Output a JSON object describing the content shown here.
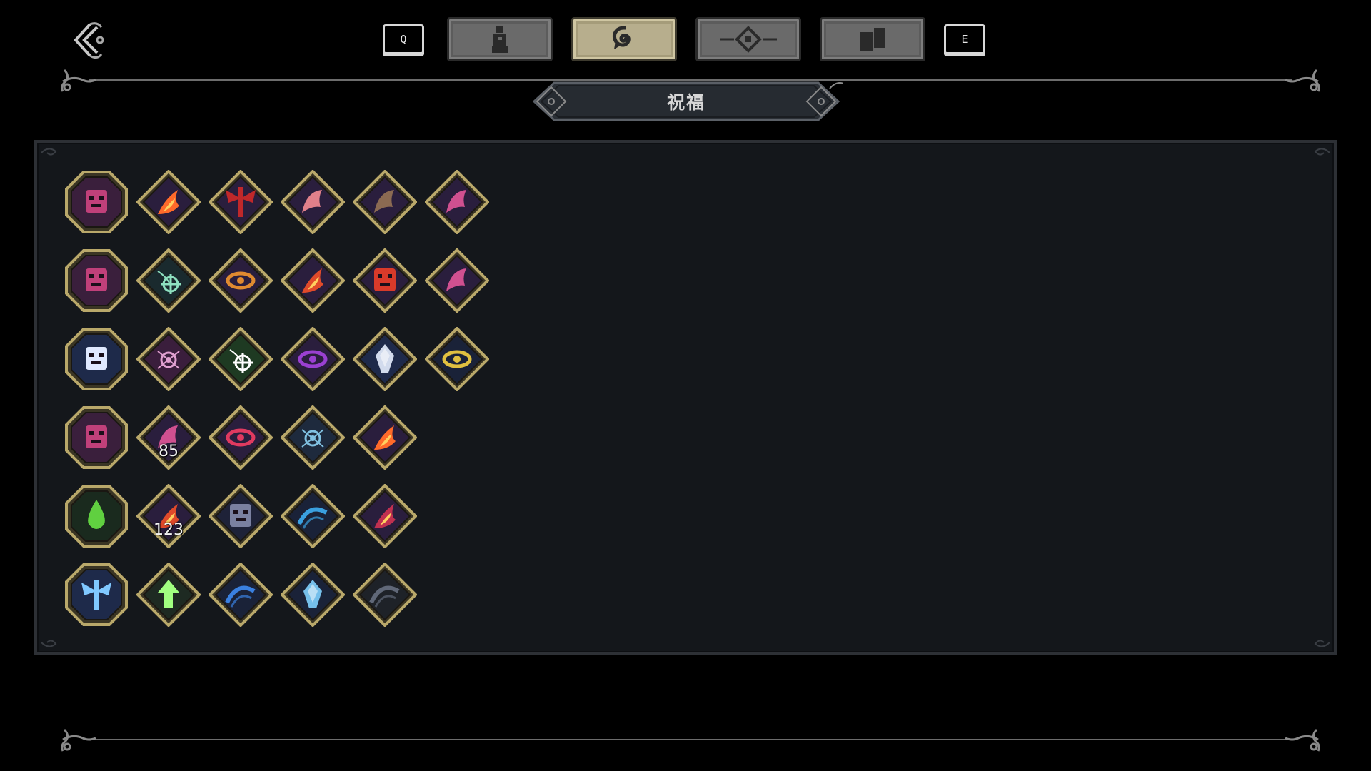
{
  "back_button": {
    "icon": "back-arrow-icon"
  },
  "tabbar": {
    "prev_key": "Q",
    "next_key": "E",
    "tabs": [
      {
        "icon": "character-icon",
        "active": false
      },
      {
        "icon": "blessing-swirl-icon",
        "active": true
      },
      {
        "icon": "diamond-target-icon",
        "active": false
      },
      {
        "icon": "cards-icon",
        "active": false
      }
    ]
  },
  "title": "祝福",
  "colors": {
    "frame_gold": "#b9a86a",
    "panel_bg": "#14171b",
    "tab_active": "#b7ae8d",
    "tab_inactive": "#6a6a6a"
  },
  "blessing_rows": [
    {
      "items": [
        {
          "shape": "octagon",
          "icon": "fist-icon",
          "bg": "#3a1f3c",
          "fg": "#c0407a"
        },
        {
          "shape": "diamond",
          "icon": "flame-slash-icon",
          "bg": "#2a1e3d",
          "fg": "#ff6a2a"
        },
        {
          "shape": "diamond",
          "icon": "crimson-wings-icon",
          "bg": "#2a1e3d",
          "fg": "#c0282a"
        },
        {
          "shape": "diamond",
          "icon": "claw-marks-icon",
          "bg": "#2a1e3d",
          "fg": "#e0808a"
        },
        {
          "shape": "diamond",
          "icon": "hooded-figure-icon",
          "bg": "#2a1e3d",
          "fg": "#8b6a52"
        },
        {
          "shape": "diamond",
          "icon": "pink-hook-icon",
          "bg": "#2a1e3d",
          "fg": "#d05090"
        }
      ]
    },
    {
      "items": [
        {
          "shape": "octagon",
          "icon": "rune-glyph-icon",
          "bg": "#3a1f3c",
          "fg": "#c0407a"
        },
        {
          "shape": "diamond",
          "icon": "crosshair-vines-icon",
          "bg": "#1a2a2e",
          "fg": "#8ee0c0"
        },
        {
          "shape": "diamond",
          "icon": "shield-eye-icon",
          "bg": "#2a1e3d",
          "fg": "#e08a30"
        },
        {
          "shape": "diamond",
          "icon": "ember-trail-icon",
          "bg": "#2a1e3d",
          "fg": "#e04a2a"
        },
        {
          "shape": "diamond",
          "icon": "demon-face-icon",
          "bg": "#2a1e3d",
          "fg": "#d83a2a"
        },
        {
          "shape": "diamond",
          "icon": "pink-blob-icon",
          "bg": "#2a1e3d",
          "fg": "#d05090"
        }
      ]
    },
    {
      "items": [
        {
          "shape": "octagon",
          "icon": "claw-strike-icon",
          "bg": "#1e2a4a",
          "fg": "#dfe8ff"
        },
        {
          "shape": "diamond",
          "icon": "web-sigil-icon",
          "bg": "#3a1e3c",
          "fg": "#e0a0d0"
        },
        {
          "shape": "diamond",
          "icon": "crosshair-spider-icon",
          "bg": "#1e3a22",
          "fg": "#ffffff"
        },
        {
          "shape": "diamond",
          "icon": "purple-eye-icon",
          "bg": "#2a1e3d",
          "fg": "#9a40d0"
        },
        {
          "shape": "diamond",
          "icon": "shatter-icon",
          "bg": "#1e2a4a",
          "fg": "#e6eeff"
        },
        {
          "shape": "diamond",
          "icon": "golden-eyes-icon",
          "bg": "#1a2238",
          "fg": "#e0c040"
        }
      ]
    },
    {
      "items": [
        {
          "shape": "octagon",
          "icon": "beast-face-icon",
          "bg": "#3a1f3c",
          "fg": "#c0407a"
        },
        {
          "shape": "diamond",
          "icon": "pink-hook-icon",
          "bg": "#2a1e3d",
          "fg": "#d05090",
          "count": "85"
        },
        {
          "shape": "diamond",
          "icon": "red-eye-icon",
          "bg": "#2a1e3d",
          "fg": "#e03a60"
        },
        {
          "shape": "diamond",
          "icon": "spider-icon",
          "bg": "#1e2a3d",
          "fg": "#80c0e0"
        },
        {
          "shape": "diamond",
          "icon": "fire-pillar-icon",
          "bg": "#2a1e3d",
          "fg": "#ff6a2a"
        }
      ]
    },
    {
      "items": [
        {
          "shape": "octagon",
          "icon": "venom-drop-icon",
          "bg": "#1a2a1e",
          "fg": "#60d040"
        },
        {
          "shape": "diamond",
          "icon": "ember-trail-icon",
          "bg": "#2a1e3d",
          "fg": "#e04a2a",
          "count": "123"
        },
        {
          "shape": "diamond",
          "icon": "horned-skull-icon",
          "bg": "#1e2238",
          "fg": "#7a80a0"
        },
        {
          "shape": "diamond",
          "icon": "blue-arc-icon",
          "bg": "#1a2238",
          "fg": "#3aa0e0"
        },
        {
          "shape": "diamond",
          "icon": "crimson-streak-icon",
          "bg": "#2a1e3d",
          "fg": "#c03050"
        }
      ]
    },
    {
      "items": [
        {
          "shape": "octagon",
          "icon": "winged-cross-icon",
          "bg": "#1e2a4a",
          "fg": "#80c8ff"
        },
        {
          "shape": "diamond",
          "icon": "green-arrow-icon",
          "bg": "#1e2a22",
          "fg": "#a0ff80"
        },
        {
          "shape": "diamond",
          "icon": "blue-wave-icon",
          "bg": "#1a2238",
          "fg": "#3a80e0"
        },
        {
          "shape": "diamond",
          "icon": "ice-crystal-icon",
          "bg": "#1a2238",
          "fg": "#80d0ff"
        },
        {
          "shape": "diamond",
          "icon": "dark-arch-icon",
          "bg": "#1e2228",
          "fg": "#606878"
        }
      ]
    }
  ]
}
